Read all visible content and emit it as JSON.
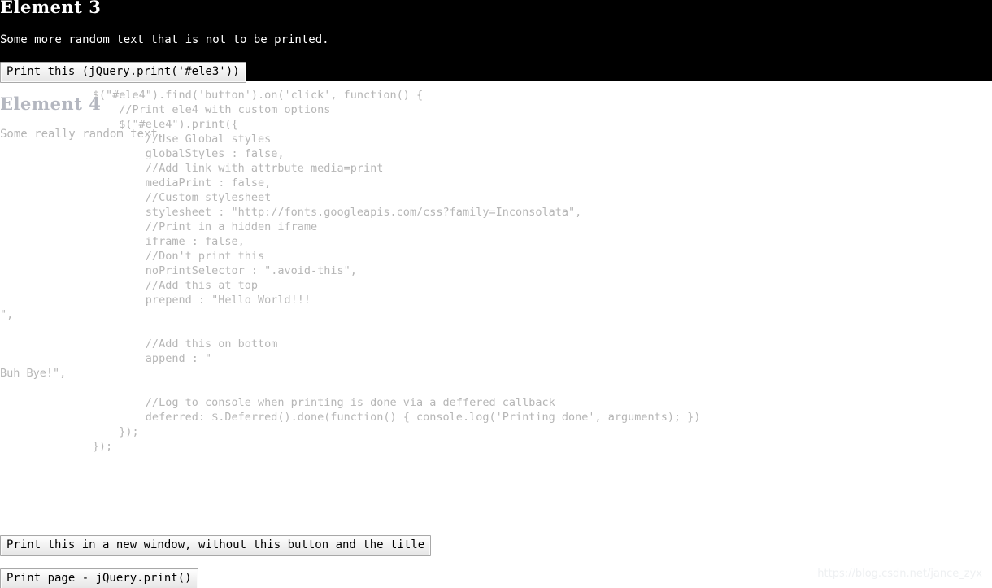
{
  "page": {
    "background_color": "#ffffff",
    "inverted_band_color": "#000000",
    "muted_text_color": "#b6b6b6",
    "watermark_color": "#eef0f2"
  },
  "element3": {
    "heading": "Element 3",
    "paragraph": "Some more random text that is not to be printed.",
    "print_button_label": "Print this (jQuery.print('#ele3'))"
  },
  "element4": {
    "heading": "Element 4",
    "paragraph": "Some really random text.",
    "code": "              $(\"#ele4\").find('button').on('click', function() {\n                  //Print ele4 with custom options\n                  $(\"#ele4\").print({\n                      //Use Global styles\n                      globalStyles : false,\n                      //Add link with attrbute media=print\n                      mediaPrint : false,\n                      //Custom stylesheet\n                      stylesheet : \"http://fonts.googleapis.com/css?family=Inconsolata\",\n                      //Print in a hidden iframe\n                      iframe : false,\n                      //Don't print this\n                      noPrintSelector : \".avoid-this\",\n                      //Add this at top\n                      prepend : \"Hello World!!!\n\",\n\n                      //Add this on bottom\n                      append : \"\nBuh Bye!\",\n\n                      //Log to console when printing is done via a deffered callback\n                      deferred: $.Deferred().done(function() { console.log('Printing done', arguments); })\n                  });\n              });"
  },
  "buttons": {
    "new_window_label": "Print this in a new window, without this button and the title",
    "print_page_label": "Print page - jQuery.print()"
  },
  "watermark": {
    "text": "https://blog.csdn.net/jance_zyx"
  }
}
